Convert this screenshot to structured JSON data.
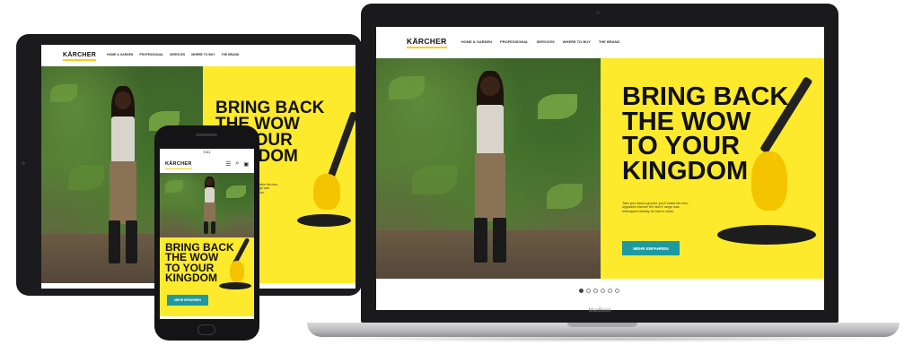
{
  "site": {
    "logo": "KÄRCHER",
    "nav_links": [
      "HOME & GARDEN",
      "PROFESSIONAL",
      "SERVICES",
      "WHERE TO BUY",
      "THE BRAND"
    ],
    "headline_lines": [
      "BRING BACK",
      "THE WOW",
      "TO YOUR",
      "KINGDOM"
    ],
    "body_copy": "Take your lawn's ground, you'll notice the new, upgraded Kärcher WV and K range was redesigned already for how to clean.",
    "cta_label": "MEHR ERFAHREN",
    "carousel_dots": 6,
    "carousel_active": 0,
    "phone_status_time": "9:41",
    "phone_menu_icon": "hamburger-icon",
    "phone_search_icon": "search-icon",
    "phone_cart_icon": "cart-icon"
  },
  "devices": {
    "laptop_brand": "MacBook"
  },
  "colors": {
    "brand_yellow": "#fdea2c",
    "cta_teal": "#1c9aa0",
    "device_dark": "#1a1a1c"
  }
}
